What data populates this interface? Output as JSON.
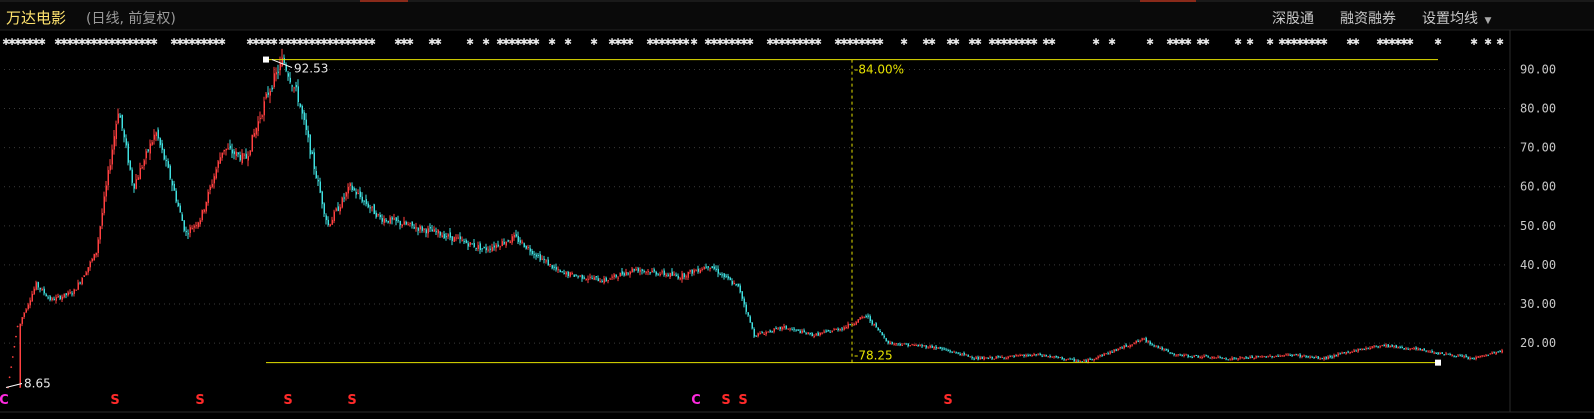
{
  "header": {
    "title": "万达电影",
    "subtitle": "(日线, 前复权)",
    "buttons": [
      "深股通",
      "融资融券",
      "设置均线"
    ]
  },
  "colors": {
    "up": "#ff4040",
    "down": "#3fe0e0",
    "annotation": "#e6e200",
    "marker": "#ff2a2a",
    "marker_alt": "#ff2adf",
    "axis_text": "#c8c8c8",
    "grid": "#3a3a3a",
    "event_glyph": "#e8e8e8"
  },
  "chart_data": {
    "type": "candlestick",
    "title": "万达电影",
    "subtitle": "(日线, 前复权)",
    "ylim": [
      8,
      96
    ],
    "yticks": [
      20,
      30,
      40,
      50,
      60,
      70,
      80,
      90
    ],
    "ytick_labels": [
      "20.00",
      "30.00",
      "40.00",
      "50.00",
      "60.00",
      "70.00",
      "80.00",
      "90.00"
    ],
    "grid": true,
    "price_path": [
      [
        0.0,
        8.65
      ],
      [
        0.01,
        26
      ],
      [
        0.02,
        35
      ],
      [
        0.03,
        31
      ],
      [
        0.045,
        33
      ],
      [
        0.06,
        43
      ],
      [
        0.075,
        80
      ],
      [
        0.085,
        60
      ],
      [
        0.1,
        74
      ],
      [
        0.11,
        62
      ],
      [
        0.12,
        48
      ],
      [
        0.13,
        52
      ],
      [
        0.145,
        70
      ],
      [
        0.16,
        67
      ],
      [
        0.175,
        84
      ],
      [
        0.185,
        92.53
      ],
      [
        0.195,
        83
      ],
      [
        0.215,
        50
      ],
      [
        0.23,
        60
      ],
      [
        0.25,
        52
      ],
      [
        0.27,
        50
      ],
      [
        0.29,
        48
      ],
      [
        0.32,
        44
      ],
      [
        0.34,
        47
      ],
      [
        0.37,
        38
      ],
      [
        0.4,
        36
      ],
      [
        0.42,
        39
      ],
      [
        0.45,
        37
      ],
      [
        0.47,
        40
      ],
      [
        0.49,
        34
      ],
      [
        0.5,
        22
      ],
      [
        0.52,
        24
      ],
      [
        0.54,
        22
      ],
      [
        0.56,
        24
      ],
      [
        0.575,
        27
      ],
      [
        0.59,
        20
      ],
      [
        0.62,
        19
      ],
      [
        0.65,
        16
      ],
      [
        0.69,
        17
      ],
      [
        0.72,
        15.2
      ],
      [
        0.74,
        18
      ],
      [
        0.76,
        21
      ],
      [
        0.78,
        17
      ],
      [
        0.82,
        16
      ],
      [
        0.86,
        17
      ],
      [
        0.88,
        16
      ],
      [
        0.9,
        18
      ],
      [
        0.92,
        19.5
      ],
      [
        0.95,
        18
      ],
      [
        0.98,
        16
      ],
      [
        1.0,
        18
      ]
    ],
    "annotations": {
      "high": {
        "value": 92.53,
        "label": "92.53"
      },
      "low": {
        "value": 8.65,
        "label": "8.65"
      },
      "range_drop_label": "-84.00%",
      "range_level_value": 15.0,
      "range_level_label": "-78.25"
    },
    "dividend_markers": [
      {
        "glyph": "S",
        "x": 115,
        "color": "marker"
      },
      {
        "glyph": "S",
        "x": 200,
        "color": "marker"
      },
      {
        "glyph": "S",
        "x": 288,
        "color": "marker"
      },
      {
        "glyph": "S",
        "x": 352,
        "color": "marker"
      },
      {
        "glyph": "C",
        "x": 696,
        "color": "marker_alt"
      },
      {
        "glyph": "S",
        "x": 726,
        "color": "marker"
      },
      {
        "glyph": "S",
        "x": 743,
        "color": "marker"
      },
      {
        "glyph": "S",
        "x": 948,
        "color": "marker"
      },
      {
        "glyph": "C",
        "x": 4,
        "color": "marker_alt"
      }
    ]
  },
  "event_strip": {
    "glyph_positions": [
      6,
      12,
      18,
      24,
      30,
      36,
      42,
      58,
      64,
      70,
      76,
      82,
      88,
      94,
      100,
      106,
      112,
      118,
      124,
      130,
      136,
      142,
      148,
      154,
      174,
      180,
      186,
      192,
      198,
      204,
      210,
      216,
      222,
      250,
      256,
      262,
      268,
      274,
      282,
      288,
      294,
      300,
      306,
      312,
      318,
      324,
      330,
      336,
      342,
      348,
      354,
      360,
      366,
      372,
      398,
      404,
      410,
      432,
      438,
      470,
      486,
      500,
      506,
      512,
      518,
      524,
      530,
      536,
      552,
      568,
      594,
      612,
      618,
      624,
      630,
      650,
      656,
      662,
      668,
      674,
      680,
      686,
      694,
      708,
      714,
      720,
      726,
      732,
      738,
      744,
      750,
      770,
      776,
      782,
      788,
      794,
      800,
      806,
      812,
      818,
      838,
      844,
      850,
      856,
      862,
      868,
      874,
      880,
      904,
      926,
      932,
      950,
      956,
      972,
      978,
      992,
      998,
      1004,
      1010,
      1016,
      1022,
      1028,
      1034,
      1046,
      1052,
      1096,
      1112,
      1150,
      1170,
      1176,
      1182,
      1188,
      1200,
      1206,
      1238,
      1250,
      1270,
      1282,
      1288,
      1294,
      1300,
      1306,
      1312,
      1318,
      1324,
      1350,
      1356,
      1380,
      1386,
      1392,
      1398,
      1404,
      1410,
      1438,
      1474,
      1488,
      1500
    ]
  }
}
